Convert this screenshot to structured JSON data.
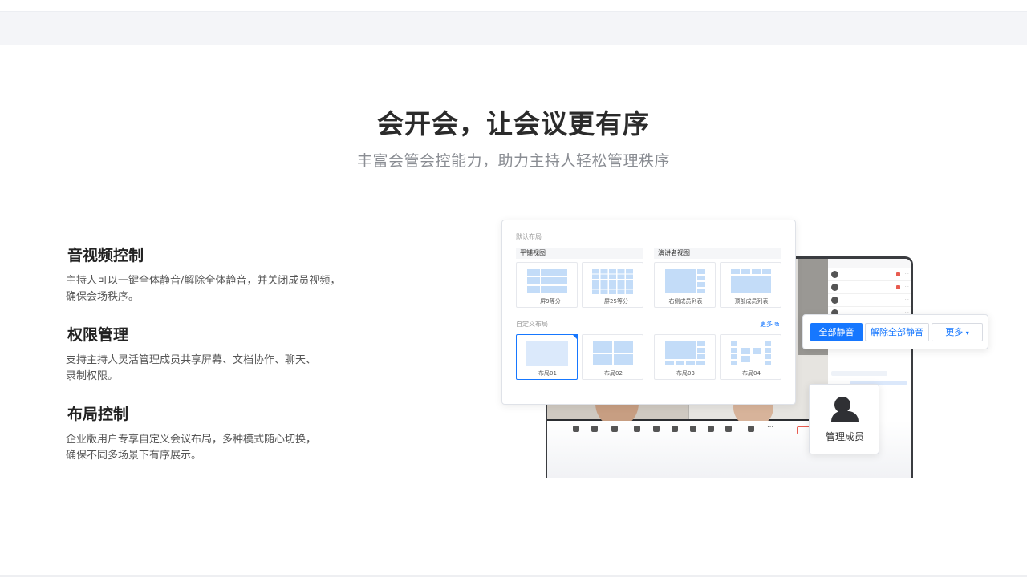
{
  "hero": {
    "title": "会开会，让会议更有序",
    "subtitle": "丰富会管会控能力，助力主持人轻松管理秩序"
  },
  "features": [
    {
      "title": "音视频控制",
      "desc_line1": "主持人可以一键全体静音/解除全体静音，并关闭成员视频，",
      "desc_line2": "确保会场秩序。"
    },
    {
      "title": "权限管理",
      "desc_line1": "支持主持人灵活管理成员共享屏幕、文档协作、聊天、",
      "desc_line2": "录制权限。"
    },
    {
      "title": "布局控制",
      "desc_line1": "企业版用户专享自定义会议布局，多种模式随心切换，",
      "desc_line2": "确保不同多场景下有序展示。"
    }
  ],
  "layout_card": {
    "heading": "默认布局",
    "group_tile": "平铺视图",
    "group_speaker": "演讲者视图",
    "default_tiles": [
      "一屏9等分",
      "一屏25等分",
      "右侧成员列表",
      "顶部成员列表"
    ],
    "custom_heading": "自定义布局",
    "more_label": "更多",
    "custom_tiles": [
      "布局01",
      "布局02",
      "布局03",
      "布局04"
    ],
    "accent": "#1677ff"
  },
  "mute_popover": {
    "mute_all": "全部静音",
    "unmute_all": "解除全部静音",
    "more": "更多"
  },
  "manage_members": {
    "label": "管理成员",
    "icon": "user-icon"
  }
}
